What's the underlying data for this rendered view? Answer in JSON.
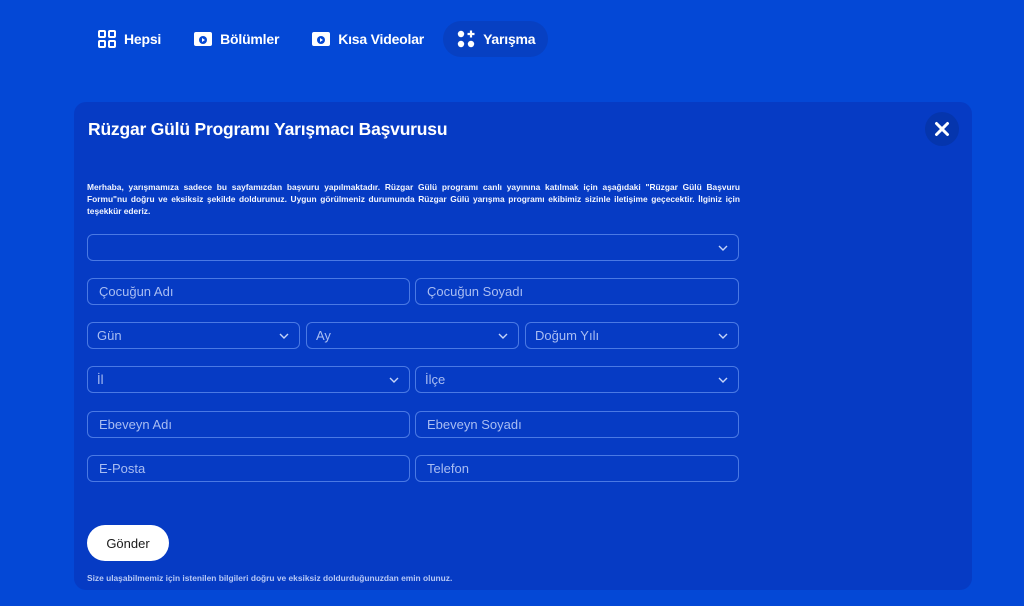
{
  "tabs": [
    {
      "label": "Hepsi",
      "icon": "grid-icon"
    },
    {
      "label": "Bölümler",
      "icon": "video-icon"
    },
    {
      "label": "Kısa Videolar",
      "icon": "video-icon"
    },
    {
      "label": "Yarışma",
      "icon": "shapes-plus-icon",
      "active": true
    }
  ],
  "form": {
    "title": "Rüzgar Gülü Programı Yarışmacı Başvurusu",
    "intro": "Merhaba, yarışmamıza sadece bu sayfamızdan başvuru yapılmaktadır. Rüzgar Gülü programı canlı yayınına katılmak için aşağıdaki \"Rüzgar Gülü Başvuru Formu\"nu doğru ve eksiksiz şekilde doldurunuz. Uygun görülmeniz durumunda Rüzgar Gülü yarışma programı ekibimiz sizinle iletişime geçecektir. İlginiz için teşekkür ederiz.",
    "program_select": "",
    "child_first_name": "Çocuğun Adı",
    "child_last_name": "Çocuğun Soyadı",
    "day": "Gün",
    "month": "Ay",
    "birth_year": "Doğum Yılı",
    "province": "İl",
    "district": "İlçe",
    "parent_first_name": "Ebeveyn Adı",
    "parent_last_name": "Ebeveyn Soyadı",
    "email": "E-Posta",
    "phone": "Telefon",
    "submit_label": "Gönder",
    "note": "Size ulaşabilmemiz için istenilen bilgileri doğru ve eksiksiz doldurduğunuzdan emin olunuz."
  },
  "colors": {
    "background": "#0448d6",
    "panel": "#063bc4",
    "field_border": "#4a79e4"
  }
}
